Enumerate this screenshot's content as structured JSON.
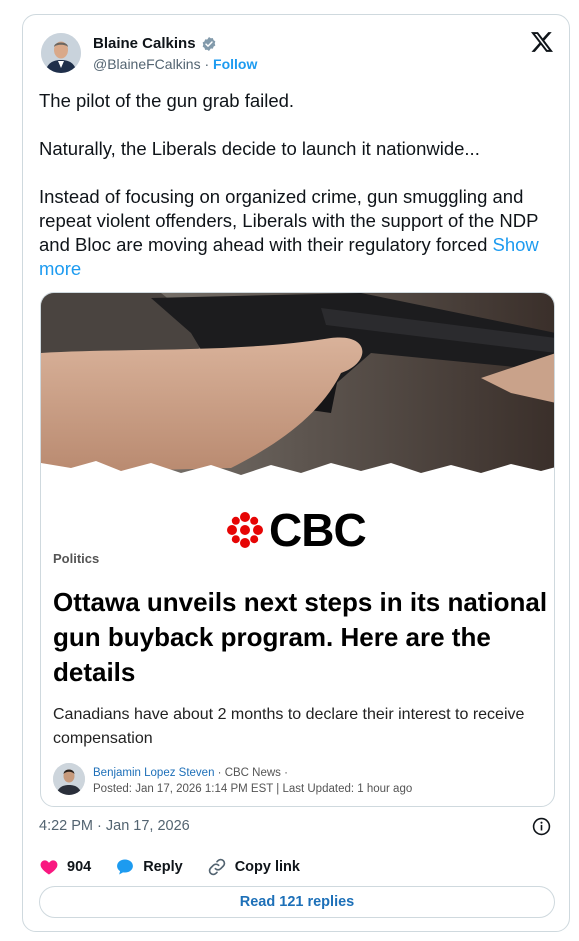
{
  "author": {
    "name": "Blaine Calkins",
    "handle": "@BlaineFCalkins",
    "separator": "·",
    "follow_label": "Follow"
  },
  "tweet": {
    "paragraphs": [
      "The pilot of the gun grab failed.",
      "Naturally, the Liberals decide to launch it nationwide...",
      "Instead of focusing on organized crime, gun smuggling and repeat violent offenders, Liberals with the support of the NDP and Bloc are moving ahead with their regulatory forced"
    ],
    "show_more_label": "Show more"
  },
  "article": {
    "logo_text": "CBC",
    "section": "Politics",
    "headline": "Ottawa unveils next steps in its national gun buyback program. Here are the details",
    "summary": "Canadians have about 2 months to declare their interest to receive compensation",
    "byline_author": "Benjamin Lopez Steven",
    "byline_source": " · CBC News ·",
    "byline_dates": "Posted: Jan 17, 2026 1:14 PM EST | Last Updated: 1 hour ago"
  },
  "meta": {
    "timestamp": "4:22 PM · Jan 17, 2026"
  },
  "actions": {
    "like_count": "904",
    "reply_label": "Reply",
    "copy_label": "Copy link",
    "read_replies_label": "Read 121 replies"
  },
  "colors": {
    "accent": "#1d9bf0",
    "like": "#f91880",
    "cbc_red": "#e60505",
    "border": "#cfd9de"
  }
}
